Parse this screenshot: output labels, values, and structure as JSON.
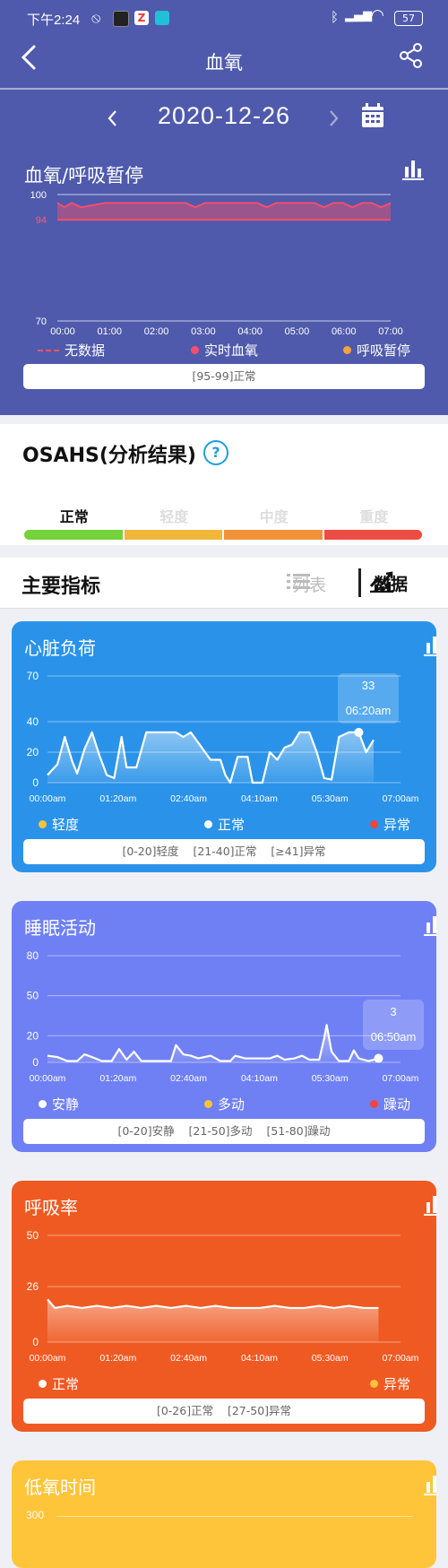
{
  "status": {
    "time": "下午2:24",
    "battery": "57"
  },
  "nav": {
    "title": "血氧",
    "date": "2020-12-26"
  },
  "oxygen_chart": {
    "title": "血氧/呼吸暂停",
    "range_text": "[95-99]正常",
    "legend": [
      {
        "label": "无数据",
        "color": "#e05a5a"
      },
      {
        "label": "实时血氧",
        "color": "#ff4d6a"
      },
      {
        "label": "呼吸暂停",
        "color": "#f7a23b"
      }
    ]
  },
  "osahs": {
    "title": "OSAHS(分析结果)",
    "levels": [
      {
        "label": "正常",
        "color": "#74d23a",
        "active": true
      },
      {
        "label": "轻度",
        "color": "#f0b73a",
        "active": false
      },
      {
        "label": "中度",
        "color": "#f0923a",
        "active": false
      },
      {
        "label": "重度",
        "color": "#ec4d43",
        "active": false
      }
    ]
  },
  "indicators": {
    "title": "主要指标",
    "list_tab": "列表",
    "data_tab": "数据"
  },
  "chart_data": [
    {
      "type": "line",
      "title": "血氧/呼吸暂停",
      "x_ticks": [
        "00:00",
        "01:00",
        "02:00",
        "03:00",
        "04:00",
        "05:00",
        "06:00",
        "07:00"
      ],
      "y_ticks": [
        "100",
        "94",
        "70"
      ],
      "ylim": [
        70,
        100
      ],
      "x_range": [
        0,
        7
      ],
      "series": [
        {
          "name": "实时血氧",
          "x": [
            0,
            0.15,
            0.3,
            0.5,
            1.0,
            1.7,
            2.3,
            2.7,
            2.9,
            3.1,
            3.4,
            3.8,
            4.2,
            4.4,
            4.6,
            5.0,
            5.4,
            5.6,
            5.8,
            6.0,
            6.2,
            6.4,
            6.6,
            6.8,
            7.0
          ],
          "y": [
            98,
            97,
            98,
            97,
            98,
            98,
            98,
            98,
            97,
            98,
            98,
            98,
            98,
            97,
            98,
            98,
            98,
            97,
            98,
            98,
            97,
            98,
            98,
            97,
            98
          ]
        }
      ],
      "band": [
        94,
        98
      ]
    },
    {
      "type": "area",
      "title": "心脏负荷",
      "x_ticks": [
        "00:00am",
        "01:20am",
        "02:40am",
        "04:10am",
        "05:30am",
        "07:00am"
      ],
      "y_ticks": [
        "70",
        "40",
        "20",
        "0"
      ],
      "ylim": [
        0,
        70
      ],
      "x_range": [
        0,
        7
      ],
      "tooltip": {
        "value": "33",
        "time": "06:20am"
      },
      "legend": [
        {
          "label": "轻度",
          "color": "#f5c43b"
        },
        {
          "label": "正常",
          "color": "#ffffff"
        },
        {
          "label": "异常",
          "color": "#f2453c"
        }
      ],
      "range_text": "[0-20]轻度    [21-40]正常    [≥41]异常",
      "values": [
        [
          0,
          5
        ],
        [
          0.2,
          12
        ],
        [
          0.35,
          30
        ],
        [
          0.5,
          14
        ],
        [
          0.6,
          6
        ],
        [
          0.75,
          22
        ],
        [
          0.9,
          33
        ],
        [
          1.05,
          18
        ],
        [
          1.2,
          5
        ],
        [
          1.35,
          3
        ],
        [
          1.5,
          30
        ],
        [
          1.6,
          10
        ],
        [
          1.8,
          10
        ],
        [
          2.0,
          33
        ],
        [
          2.3,
          33
        ],
        [
          2.6,
          33
        ],
        [
          2.75,
          30
        ],
        [
          2.9,
          33
        ],
        [
          3.1,
          24
        ],
        [
          3.3,
          15
        ],
        [
          3.5,
          15
        ],
        [
          3.6,
          5
        ],
        [
          3.7,
          0
        ],
        [
          3.85,
          17
        ],
        [
          4.05,
          17
        ],
        [
          4.15,
          0
        ],
        [
          4.35,
          0
        ],
        [
          4.5,
          20
        ],
        [
          4.65,
          15
        ],
        [
          4.8,
          23
        ],
        [
          4.95,
          25
        ],
        [
          5.1,
          33
        ],
        [
          5.3,
          33
        ],
        [
          5.45,
          20
        ],
        [
          5.6,
          3
        ],
        [
          5.75,
          2
        ],
        [
          5.9,
          30
        ],
        [
          6.1,
          33
        ],
        [
          6.3,
          33
        ],
        [
          6.45,
          20
        ],
        [
          6.6,
          28
        ]
      ]
    },
    {
      "type": "area",
      "title": "睡眠活动",
      "x_ticks": [
        "00:00am",
        "01:20am",
        "02:40am",
        "04:10am",
        "05:30am",
        "07:00am"
      ],
      "y_ticks": [
        "80",
        "50",
        "20",
        "0"
      ],
      "ylim": [
        0,
        80
      ],
      "x_range": [
        0,
        7
      ],
      "tooltip": {
        "value": "3",
        "time": "06:50am"
      },
      "legend": [
        {
          "label": "安静",
          "color": "#ffffff"
        },
        {
          "label": "多动",
          "color": "#f5c43b"
        },
        {
          "label": "躁动",
          "color": "#f2453c"
        }
      ],
      "range_text": "[0-20]安静    [21-50]多动    [51-80]躁动",
      "values": [
        [
          0,
          5
        ],
        [
          0.2,
          4
        ],
        [
          0.4,
          1
        ],
        [
          0.6,
          1
        ],
        [
          0.75,
          6
        ],
        [
          0.9,
          4
        ],
        [
          1.1,
          1
        ],
        [
          1.3,
          1
        ],
        [
          1.45,
          10
        ],
        [
          1.6,
          2
        ],
        [
          1.75,
          8
        ],
        [
          1.9,
          1
        ],
        [
          2.2,
          1
        ],
        [
          2.5,
          1
        ],
        [
          2.6,
          13
        ],
        [
          2.75,
          6
        ],
        [
          2.9,
          5
        ],
        [
          3.05,
          3
        ],
        [
          3.3,
          5
        ],
        [
          3.5,
          1
        ],
        [
          3.7,
          1
        ],
        [
          3.8,
          5
        ],
        [
          4.0,
          3
        ],
        [
          4.2,
          3
        ],
        [
          4.5,
          3
        ],
        [
          4.65,
          5
        ],
        [
          4.8,
          2
        ],
        [
          5.0,
          3
        ],
        [
          5.15,
          5
        ],
        [
          5.3,
          2
        ],
        [
          5.5,
          2
        ],
        [
          5.6,
          18
        ],
        [
          5.65,
          28
        ],
        [
          5.75,
          8
        ],
        [
          5.9,
          1
        ],
        [
          6.1,
          1
        ],
        [
          6.2,
          9
        ],
        [
          6.3,
          3
        ],
        [
          6.5,
          1
        ],
        [
          6.7,
          3
        ]
      ]
    },
    {
      "type": "area",
      "title": "呼吸率",
      "x_ticks": [
        "00:00am",
        "01:20am",
        "02:40am",
        "04:10am",
        "05:30am",
        "07:00am"
      ],
      "y_ticks": [
        "50",
        "26",
        "0"
      ],
      "ylim": [
        0,
        50
      ],
      "x_range": [
        0,
        7
      ],
      "legend": [
        {
          "label": "正常",
          "color": "#ffffff"
        },
        {
          "label": "异常",
          "color": "#f5c43b"
        }
      ],
      "range_text": "[0-26]正常    [27-50]异常",
      "values": [
        [
          0,
          20
        ],
        [
          0.15,
          16
        ],
        [
          0.4,
          17
        ],
        [
          0.7,
          16
        ],
        [
          1.0,
          17
        ],
        [
          1.3,
          16
        ],
        [
          1.6,
          17
        ],
        [
          1.9,
          16
        ],
        [
          2.2,
          17
        ],
        [
          2.5,
          16
        ],
        [
          2.8,
          17
        ],
        [
          3.1,
          16
        ],
        [
          3.4,
          17
        ],
        [
          3.7,
          16
        ],
        [
          4.0,
          16
        ],
        [
          4.3,
          16
        ],
        [
          4.6,
          17
        ],
        [
          4.9,
          16
        ],
        [
          5.2,
          16
        ],
        [
          5.5,
          17
        ],
        [
          5.8,
          16
        ],
        [
          6.1,
          17
        ],
        [
          6.4,
          16
        ],
        [
          6.7,
          16
        ]
      ]
    },
    {
      "type": "area",
      "title": "低氧时间",
      "y_ticks": [
        "300"
      ]
    }
  ]
}
